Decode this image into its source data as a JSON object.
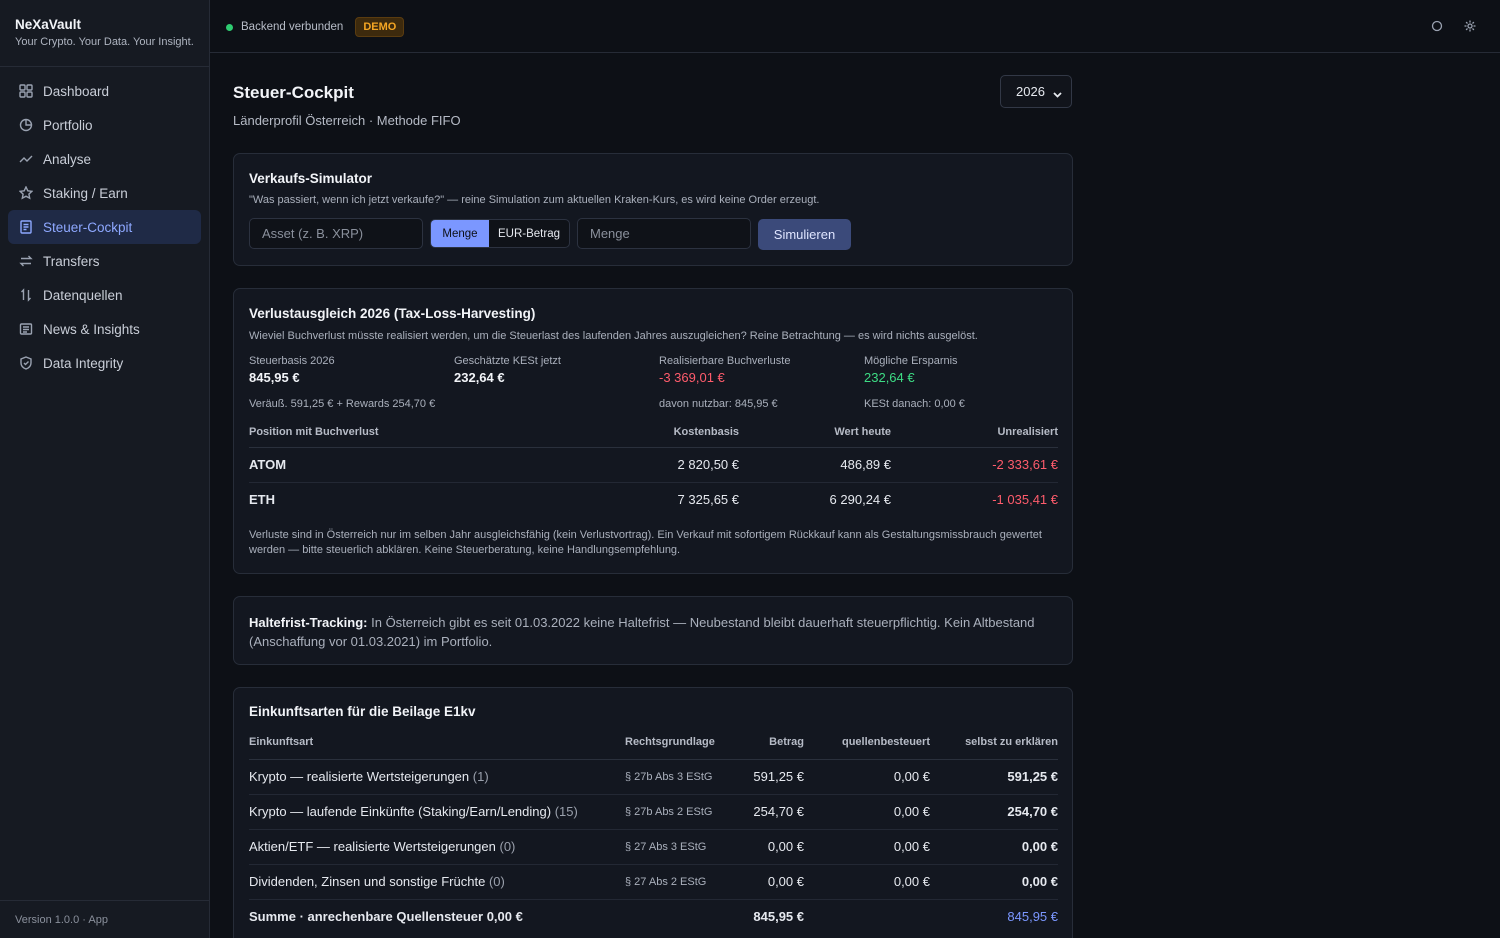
{
  "app": {
    "name": "NeXaVault",
    "tagline": "Your Crypto. Your Data. Your Insight.",
    "version": "Version 1.0.0 · App"
  },
  "sidebar": {
    "items": [
      {
        "label": "Dashboard",
        "icon": "grid-icon"
      },
      {
        "label": "Portfolio",
        "icon": "pie-chart-icon"
      },
      {
        "label": "Analyse",
        "icon": "trend-line-icon"
      },
      {
        "label": "Staking / Earn",
        "icon": "star-icon"
      },
      {
        "label": "Steuer-Cockpit",
        "icon": "document-icon",
        "active": true
      },
      {
        "label": "Transfers",
        "icon": "swap-arrows-icon"
      },
      {
        "label": "Datenquellen",
        "icon": "up-down-arrows-icon"
      },
      {
        "label": "News & Insights",
        "icon": "newspaper-icon"
      },
      {
        "label": "Data Integrity",
        "icon": "shield-icon"
      }
    ]
  },
  "topbar": {
    "status": "Backend verbunden",
    "badge": "DEMO",
    "status_color": "#2ecc71",
    "badge_color": "#f5a623"
  },
  "page": {
    "title": "Steuer-Cockpit",
    "subtitle": "Länderprofil Österreich · Methode FIFO",
    "year": "2026"
  },
  "simulator": {
    "title": "Verkaufs-Simulator",
    "desc": "\"Was passiert, wenn ich jetzt verkaufe?\" — reine Simulation zum aktuellen Kraken-Kurs, es wird keine Order erzeugt.",
    "asset_placeholder": "Asset (z. B. XRP)",
    "mode_qty": "Menge",
    "mode_eur": "EUR-Betrag",
    "qty_placeholder": "Menge",
    "button": "Simulieren"
  },
  "loss": {
    "title": "Verlustausgleich 2026 (Tax-Loss-Harvesting)",
    "desc": "Wieviel Buchverlust müsste realisiert werden, um die Steuerlast des laufenden Jahres auszugleichen? Reine Betrachtung — es wird nichts ausgelöst.",
    "stats": [
      {
        "label": "Steuerbasis 2026",
        "value": "845,95 €",
        "note": "Veräuß. 591,25 € + Rewards 254,70 €"
      },
      {
        "label": "Geschätzte KESt jetzt",
        "value": "232,64 €",
        "note": ""
      },
      {
        "label": "Realisierbare Buchverluste",
        "value": "-3 369,01 €",
        "note": "davon nutzbar: 845,95 €"
      },
      {
        "label": "Mögliche Ersparnis",
        "value": "232,64 €",
        "note": "KESt danach: 0,00 €"
      }
    ],
    "columns": [
      "Position mit Buchverlust",
      "Kostenbasis",
      "Wert heute",
      "Unrealisiert"
    ],
    "rows": [
      {
        "asset": "ATOM",
        "cost": "2 820,50 €",
        "value": "486,89 €",
        "unrealized": "-2 333,61 €"
      },
      {
        "asset": "ETH",
        "cost": "7 325,65 €",
        "value": "6 290,24 €",
        "unrealized": "-1 035,41 €"
      }
    ],
    "note": "Verluste sind in Österreich nur im selben Jahr ausgleichsfähig (kein Verlustvortrag). Ein Verkauf mit sofortigem Rückkauf kann als Gestaltungsmissbrauch gewertet werden — bitte steuerlich abklären. Keine Steuerberatung, keine Handlungsempfehlung."
  },
  "holding": {
    "label": "Haltefrist-Tracking:",
    "text": "In Österreich gibt es seit 01.03.2022 keine Haltefrist — Neubestand bleibt dauerhaft steuerpflichtig. Kein Altbestand (Anschaffung vor 01.03.2021) im Portfolio."
  },
  "income": {
    "title": "Einkunftsarten für die Beilage E1kv",
    "columns": [
      "Einkunftsart",
      "Rechtsgrundlage",
      "Betrag",
      "quellenbesteuert",
      "selbst zu erklären"
    ],
    "rows": [
      {
        "type": "Krypto — realisierte Wertsteigerungen",
        "count": "(1)",
        "law": "§ 27b Abs 3 EStG",
        "amount": "591,25 €",
        "withheld": "0,00 €",
        "declare": "591,25 €"
      },
      {
        "type": "Krypto — laufende Einkünfte (Staking/Earn/Lending)",
        "count": "(15)",
        "law": "§ 27b Abs 2 EStG",
        "amount": "254,70 €",
        "withheld": "0,00 €",
        "declare": "254,70 €"
      },
      {
        "type": "Aktien/ETF — realisierte Wertsteigerungen",
        "count": "(0)",
        "law": "§ 27 Abs 3 EStG",
        "amount": "0,00 €",
        "withheld": "0,00 €",
        "declare": "0,00 €"
      },
      {
        "type": "Dividenden, Zinsen und sonstige Früchte",
        "count": "(0)",
        "law": "§ 27 Abs 2 EStG",
        "amount": "0,00 €",
        "withheld": "0,00 €",
        "declare": "0,00 €"
      }
    ],
    "sum": {
      "label": "Summe · anrechenbare Quellensteuer 0,00 €",
      "amount": "845,95 €",
      "declare": "845,95 €"
    }
  }
}
